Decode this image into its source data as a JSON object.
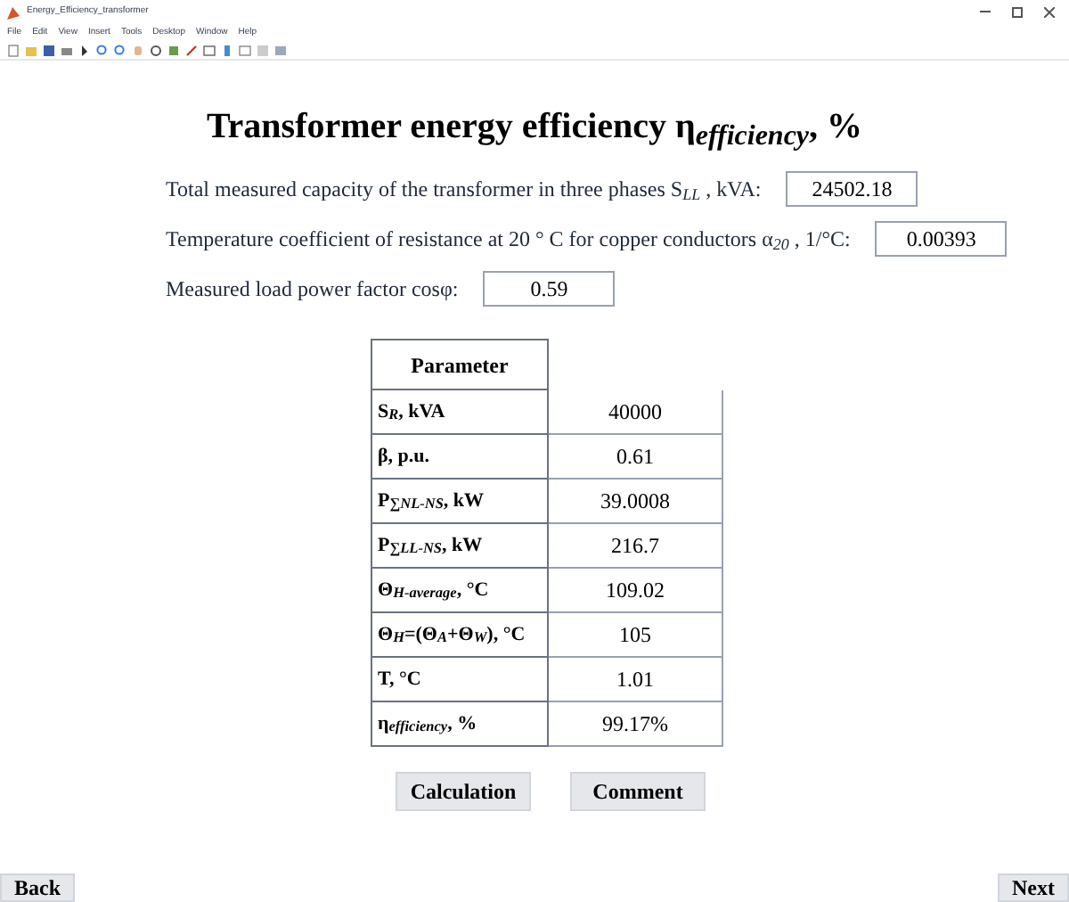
{
  "window": {
    "title": "Energy_Efficiency_transformer"
  },
  "menu": [
    "File",
    "Edit",
    "View",
    "Insert",
    "Tools",
    "Desktop",
    "Window",
    "Help"
  ],
  "heading": "Transformer energy efficiency η$_{efficiency}$, %",
  "inputs": [
    {
      "label": "Total measured capacity of the transformer in three phases S$_{LL}$ , kVA:",
      "value": "24502.18"
    },
    {
      "label": "Temperature coefficient of resistance at 20 ° C for copper conductors  α$_{20}$ , 1/°C:",
      "value": "0.00393"
    },
    {
      "label": "Measured load power factor cosφ:",
      "value": "0.59"
    }
  ],
  "table": {
    "columns": [
      "Parameter"
    ],
    "rows": [
      {
        "parameter": "S$_{R}$, kVA",
        "value": "40000"
      },
      {
        "parameter": "β, p.u.",
        "value": "0.61"
      },
      {
        "parameter": "P$_{∑NL-NS}$, kW",
        "value": "39.0008"
      },
      {
        "parameter": "P$_{∑LL-NS}$, kW",
        "value": "216.7"
      },
      {
        "parameter": "Θ$_{H-average}$, °C",
        "value": "109.02"
      },
      {
        "parameter": "Θ$_{H}$=(Θ$_{A}$+Θ$_{W}$), °C",
        "value": "105"
      },
      {
        "parameter": "T, °C",
        "value": "1.01"
      },
      {
        "parameter": "η$_{efficiency}$, %",
        "value": "99.17%"
      }
    ]
  },
  "buttons": [
    "Calculation",
    "Comment"
  ],
  "nav": {
    "back": "Back",
    "next": "Next"
  }
}
